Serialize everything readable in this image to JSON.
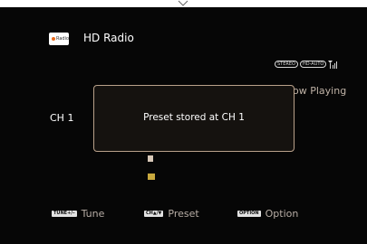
{
  "header": {
    "logo_text": "Radio",
    "title": "HD Radio"
  },
  "status_badges": [
    "STEREO",
    "HD-AUTO"
  ],
  "now_playing": "ow Playing",
  "channel_label": "CH 1",
  "dialog": {
    "message": "Preset stored at CH 1"
  },
  "footer": [
    {
      "key": "TUNE+/–",
      "label": "Tune"
    },
    {
      "key": "CH▲/▼",
      "label": "Preset"
    },
    {
      "key": "OPTION",
      "label": "Option"
    }
  ],
  "colors": {
    "background": "#060606",
    "dialog_border": "#b9a18a",
    "text_dim": "#b7ada5"
  }
}
